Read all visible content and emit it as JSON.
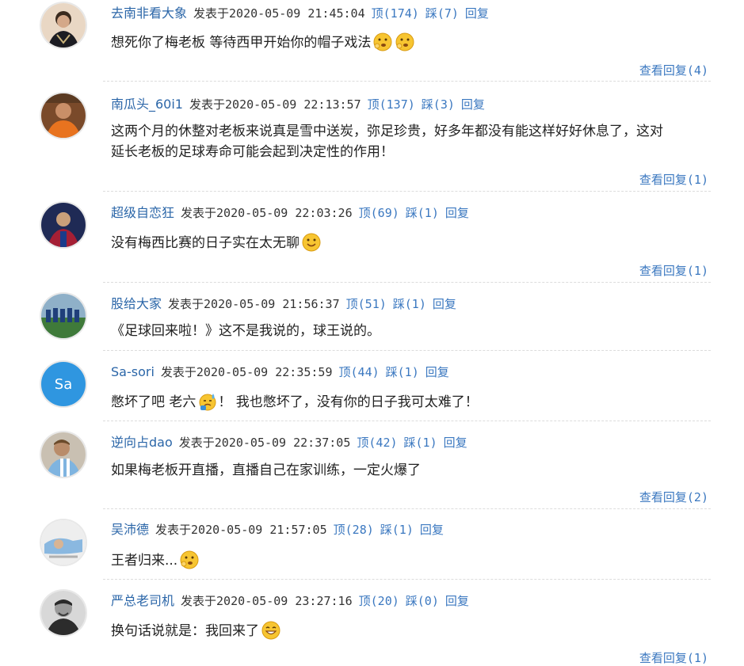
{
  "posted_label": "发表于",
  "up_label": "顶",
  "down_label": "踩",
  "reply_label": "回复",
  "view_label": "查看回复",
  "link_color": "#3b78c0",
  "comments": [
    {
      "user": "去南非看大象",
      "time": "2020-05-09 21:45:04",
      "up": "(174)",
      "down": "(7)",
      "text": "想死你了梅老板 等待西甲开始你的帽子戏法",
      "text2": "",
      "text3": "",
      "replies": "(4)",
      "avatar_icon": "user-avatar-photo"
    },
    {
      "user": "南瓜头_60i1",
      "time": "2020-05-09 22:13:57",
      "up": "(137)",
      "down": "(3)",
      "text": "这两个月的休整对老板来说真是雪中送炭，弥足珍贵，好多年都没有能这样好好休息了，这对",
      "text2": "延长老板的足球寿命可能会起到决定性的作用！",
      "text3": "",
      "replies": "(1)",
      "avatar_icon": "user-avatar-photo"
    },
    {
      "user": "超级自恋狂",
      "time": "2020-05-09 22:03:26",
      "up": "(69)",
      "down": "(1)",
      "text": "没有梅西比赛的日子实在太无聊",
      "text2": "",
      "text3": "",
      "replies": "(1)",
      "avatar_icon": "user-avatar-photo"
    },
    {
      "user": "股给大家",
      "time": "2020-05-09 21:56:37",
      "up": "(51)",
      "down": "(1)",
      "text": "《足球回来啦！》这不是我说的，球王说的。",
      "text2": "",
      "text3": "",
      "replies": "",
      "avatar_icon": "user-avatar-photo"
    },
    {
      "user": "Sa-sori",
      "time": "2020-05-09 22:35:59",
      "up": "(44)",
      "down": "(1)",
      "text": "憋坏了吧 老六",
      "text2": "！ 我也憋坏了，没有你的日子我可太难了！",
      "text3": "",
      "replies": "",
      "avatar_icon": "user-avatar-initials",
      "avatar_initials": "Sa"
    },
    {
      "user": "逆向占dao",
      "time": "2020-05-09 22:37:05",
      "up": "(42)",
      "down": "(1)",
      "text": "如果梅老板开直播，直播自己在家训练，一定火爆了",
      "text2": "",
      "text3": "",
      "replies": "(2)",
      "avatar_icon": "user-avatar-photo"
    },
    {
      "user": "吴沛德",
      "time": "2020-05-09 21:57:05",
      "up": "(28)",
      "down": "(1)",
      "text": "王者归来...",
      "text2": "",
      "text3": "",
      "replies": "",
      "avatar_icon": "user-avatar-photo"
    },
    {
      "user": "严总老司机",
      "time": "2020-05-09 23:27:16",
      "up": "(20)",
      "down": "(0)",
      "text": "换句话说就是：我回来了",
      "text2": "",
      "text3": "",
      "replies": "(1)",
      "avatar_icon": "user-avatar-photo"
    }
  ]
}
